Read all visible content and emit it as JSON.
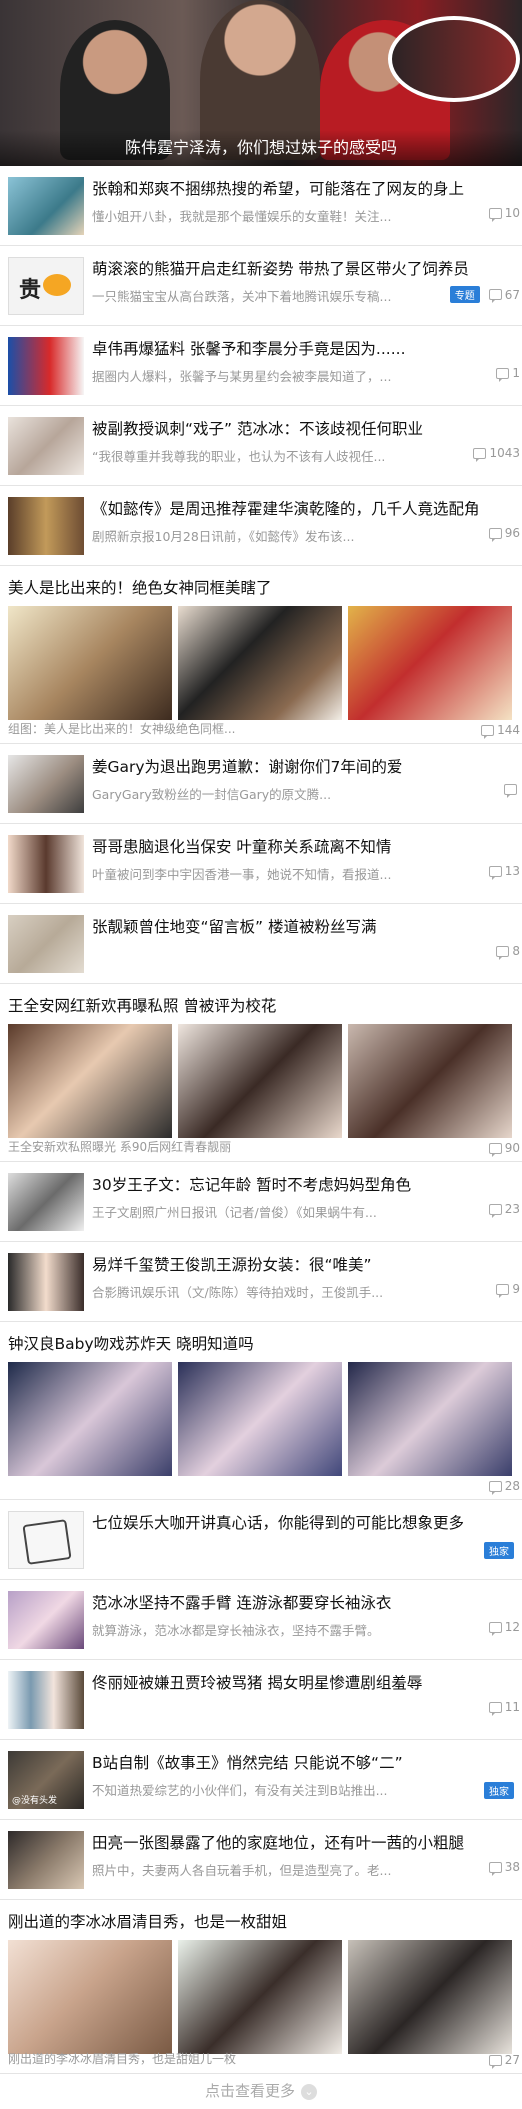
{
  "hero": {
    "caption": "陈伟霆宁泽涛，你们想过妹子的感受吗"
  },
  "articles": [
    {
      "title": "张翰和郑爽不捆绑热搜的希望，可能落在了网友的身上",
      "summary": "懂小姐开八卦，我就是那个最懂娱乐的女童鞋！关注...",
      "comments": "10",
      "tag": ""
    },
    {
      "title": "萌滚滚的熊猫开启走红新姿势 带热了景区带火了饲养员",
      "summary": "一只熊猫宝宝从高台跌落，关冲下着地腾讯娱乐专稿...",
      "comments": "67",
      "tag": "专题"
    },
    {
      "title": "卓伟再爆猛料 张馨予和李晨分手竟是因为......",
      "summary": "据圈内人爆料，张馨予与某男星约会被李晨知道了，...",
      "comments": "1",
      "tag": ""
    },
    {
      "title": "被副教授讽刺“戏子” 范冰冰：不该歧视任何职业",
      "summary": "“我很尊重并我尊我的职业，也认为不该有人歧视任...",
      "comments": "1043",
      "tag": ""
    },
    {
      "title": "《如懿传》是周迅推荐霍建华演乾隆的，几千人竟选配角",
      "summary": "剧照新京报10月28日讯前，《如懿传》发布该...",
      "comments": "96",
      "tag": ""
    },
    {
      "title": "姜Gary为退出跑男道歉：谢谢你们7年间的爱",
      "summary": "GaryGary致粉丝的一封信Gary的原文腾...",
      "comments": "",
      "tag": ""
    },
    {
      "title": "哥哥患脑退化当保安 叶童称关系疏离不知情",
      "summary": "叶童被问到李中宇因香港一事，她说不知情，看报道...",
      "comments": "13",
      "tag": ""
    },
    {
      "title": "张靓颖曾住地变“留言板” 楼道被粉丝写满",
      "summary": "",
      "comments": "8",
      "tag": ""
    },
    {
      "title": "30岁王子文：忘记年龄 暂时不考虑妈妈型角色",
      "summary": "王子文剧照广州日报讯（记者/曾俊）《如果蜗牛有...",
      "comments": "23",
      "tag": ""
    },
    {
      "title": "易烊千玺赞王俊凯王源扮女装：很“唯美”",
      "summary": "合影腾讯娱乐讯（文/陈陈）等待拍戏时，王俊凯手...",
      "comments": "9",
      "tag": ""
    },
    {
      "title": "七位娱乐大咖开讲真心话，你能得到的可能比想象更多",
      "summary": "",
      "comments": "",
      "tag": "独家"
    },
    {
      "title": "范冰冰坚持不露手臂 连游泳都要穿长袖泳衣",
      "summary": "就算游泳，范冰冰都是穿长袖泳衣，坚持不露手臂。",
      "comments": "12",
      "tag": ""
    },
    {
      "title": "佟丽娅被嫌丑贾玲被骂猪 揭女明星惨遭剧组羞辱",
      "summary": "",
      "comments": "11",
      "tag": ""
    },
    {
      "title": "B站自制《故事王》悄然完结 只能说不够“二”",
      "summary": "不知道热爱综艺的小伙伴们，有没有关注到B站推出...",
      "comments": "",
      "tag": "独家"
    },
    {
      "title": "田亮一张图暴露了他的家庭地位，还有叶一茜的小粗腿",
      "summary": "照片中，夫妻两人各自玩着手机，但是造型亮了。老...",
      "comments": "38",
      "tag": ""
    }
  ],
  "thumb_captions": {
    "a1": "",
    "a14": "@没有头发"
  },
  "galleries": [
    {
      "title": "美人是比出来的！绝色女神同框美瞎了",
      "summary": "组图：美人是比出来的！女神级绝色同框...",
      "comments": "144"
    },
    {
      "title": "王全安网红新欢再曝私照 曾被评为校花",
      "summary": "王全安新欢私照曝光 系90后网红青春靓丽",
      "comments": "90"
    },
    {
      "title": "钟汉良Baby吻戏苏炸天 晓明知道吗",
      "summary": "",
      "comments": "28"
    },
    {
      "title": "刚出道的李冰冰眉清目秀，也是一枚甜姐",
      "summary": "刚出道的李冰冰眉清目秀，也是甜姐儿一枚",
      "comments": "27"
    }
  ],
  "load_more": "点击查看更多"
}
